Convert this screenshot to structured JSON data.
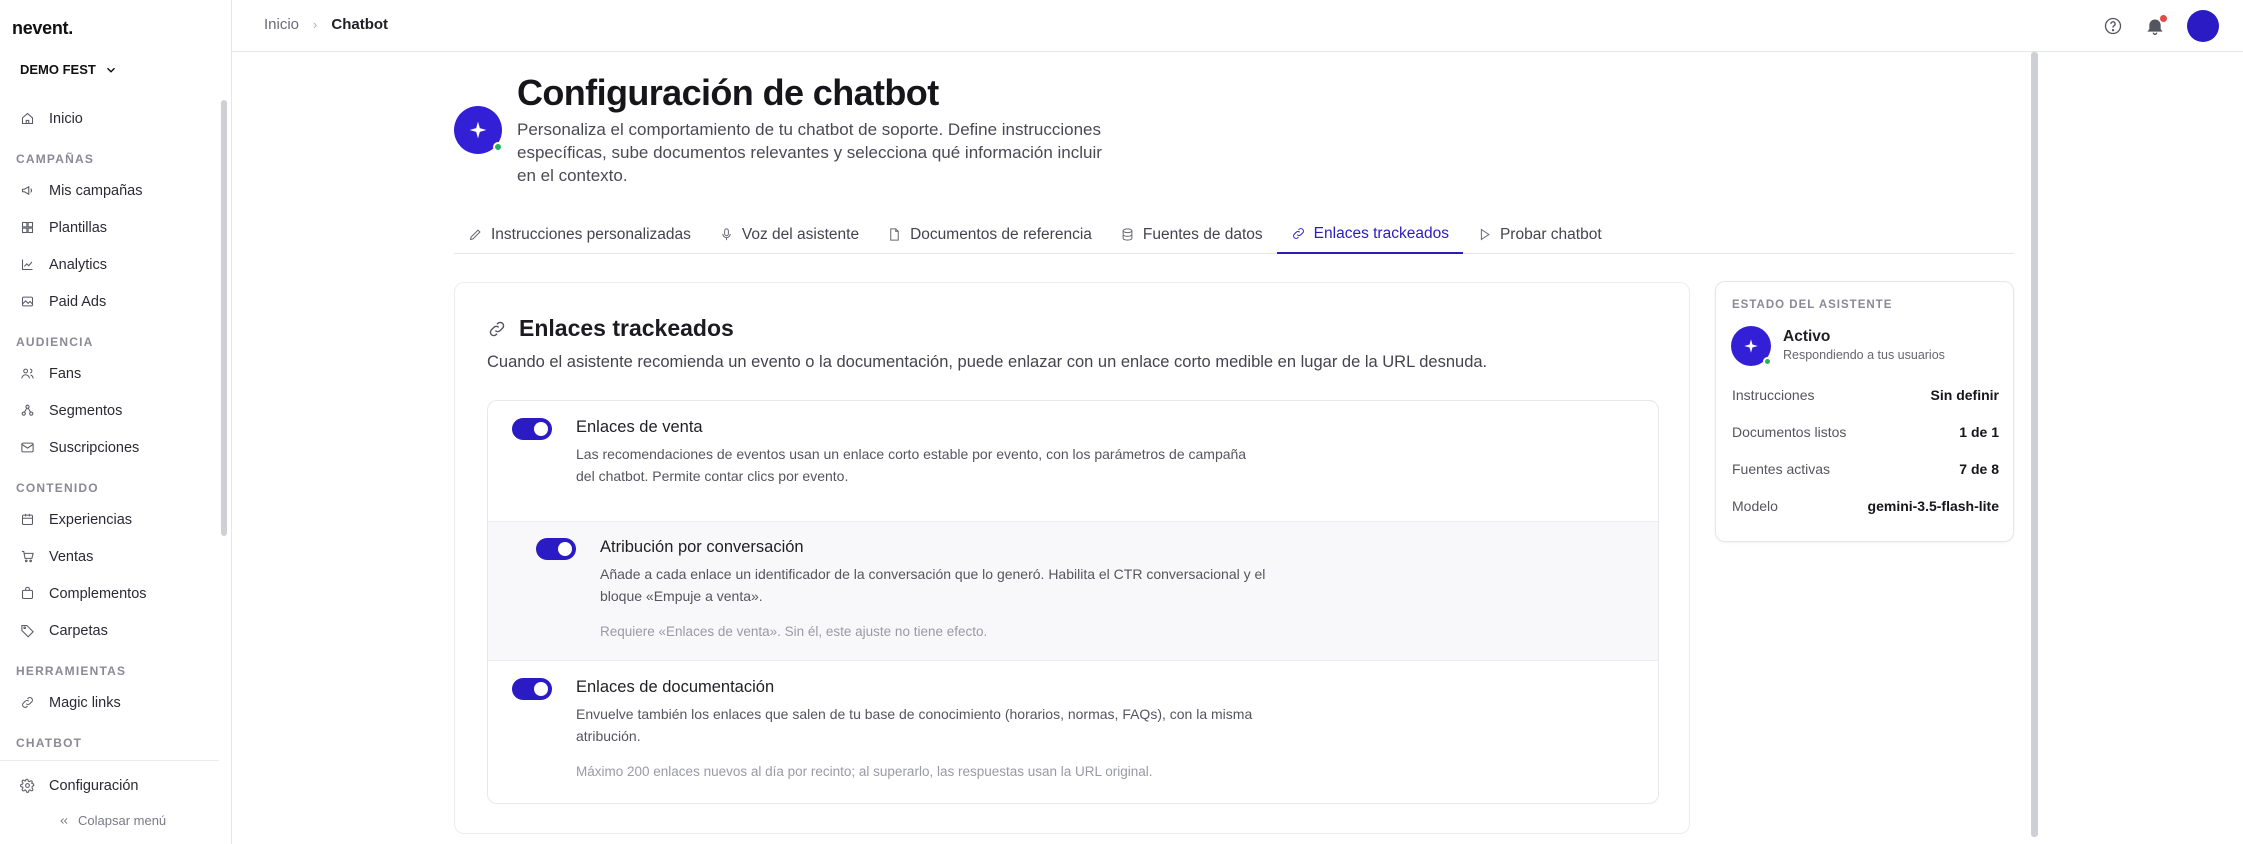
{
  "app": {
    "logo": "nevent.",
    "org": "DEMO FEST"
  },
  "sidebar": {
    "items": [
      {
        "type": "item",
        "label": "Inicio",
        "icon": "home-icon"
      },
      {
        "type": "section",
        "label": "CAMPAÑAS"
      },
      {
        "type": "item",
        "label": "Mis campañas",
        "icon": "megaphone-icon"
      },
      {
        "type": "item",
        "label": "Plantillas",
        "icon": "grid-icon"
      },
      {
        "type": "item",
        "label": "Analytics",
        "icon": "chart-line-icon"
      },
      {
        "type": "item",
        "label": "Paid Ads",
        "icon": "image-icon"
      },
      {
        "type": "section",
        "label": "AUDIENCIA"
      },
      {
        "type": "item",
        "label": "Fans",
        "icon": "users-icon"
      },
      {
        "type": "item",
        "label": "Segmentos",
        "icon": "segments-icon"
      },
      {
        "type": "item",
        "label": "Suscripciones",
        "icon": "mail-icon"
      },
      {
        "type": "section",
        "label": "CONTENIDO"
      },
      {
        "type": "item",
        "label": "Experiencias",
        "icon": "calendar-icon"
      },
      {
        "type": "item",
        "label": "Ventas",
        "icon": "cart-icon"
      },
      {
        "type": "item",
        "label": "Complementos",
        "icon": "bag-icon"
      },
      {
        "type": "item",
        "label": "Carpetas",
        "icon": "tag-icon"
      },
      {
        "type": "section",
        "label": "HERRAMIENTAS"
      },
      {
        "type": "item",
        "label": "Magic links",
        "icon": "link-icon"
      },
      {
        "type": "section",
        "label": "CHATBOT"
      }
    ],
    "settings_label": "Configuración",
    "collapse_label": "Colapsar menú"
  },
  "breadcrumb": {
    "home": "Inicio",
    "current": "Chatbot"
  },
  "header": {
    "title": "Configuración de chatbot",
    "description": "Personaliza el comportamiento de tu chatbot de soporte. Define instrucciones específicas, sube documentos relevantes y selecciona qué información incluir en el contexto."
  },
  "tabs": [
    {
      "label": "Instrucciones personalizadas",
      "icon": "pencil-icon",
      "active": false
    },
    {
      "label": "Voz del asistente",
      "icon": "microphone-icon",
      "active": false
    },
    {
      "label": "Documentos de referencia",
      "icon": "document-icon",
      "active": false
    },
    {
      "label": "Fuentes de datos",
      "icon": "database-icon",
      "active": false
    },
    {
      "label": "Enlaces trackeados",
      "icon": "link-icon",
      "active": true
    },
    {
      "label": "Probar chatbot",
      "icon": "play-icon",
      "active": false
    }
  ],
  "panel": {
    "title": "Enlaces trackeados",
    "description": "Cuando el asistente recomienda un evento o la documentación, puede enlazar con un enlace corto medible en lugar de la URL desnuda.",
    "options": [
      {
        "title": "Enlaces de venta",
        "description": "Las recomendaciones de eventos usan un enlace corto estable por evento, con los parámetros de campaña del chatbot. Permite contar clics por evento.",
        "enabled": true
      },
      {
        "title": "Atribución por conversación",
        "description": "Añade a cada enlace un identificador de la conversación que lo generó. Habilita el CTR conversacional y el bloque «Empuje a venta».",
        "note": "Requiere «Enlaces de venta». Sin él, este ajuste no tiene efecto.",
        "enabled": true
      },
      {
        "title": "Enlaces de documentación",
        "description": "Envuelve también los enlaces que salen de tu base de conocimiento (horarios, normas, FAQs), con la misma atribución.",
        "note": "Máximo 200 enlaces nuevos al día por recinto; al superarlo, las respuestas usan la URL original.",
        "enabled": true
      }
    ]
  },
  "status_card": {
    "label": "ESTADO DEL ASISTENTE",
    "status": "Activo",
    "substatus": "Respondiendo a tus usuarios",
    "rows": [
      {
        "key": "Instrucciones",
        "value": "Sin definir"
      },
      {
        "key": "Documentos listos",
        "value": "1 de 1"
      },
      {
        "key": "Fuentes activas",
        "value": "7 de 8"
      },
      {
        "key": "Modelo",
        "value": "gemini-3.5-flash-lite"
      }
    ]
  },
  "colors": {
    "accent": "#2a1bc4",
    "badge": "#3320d6",
    "online": "#22b35a",
    "notification": "#e54848"
  }
}
